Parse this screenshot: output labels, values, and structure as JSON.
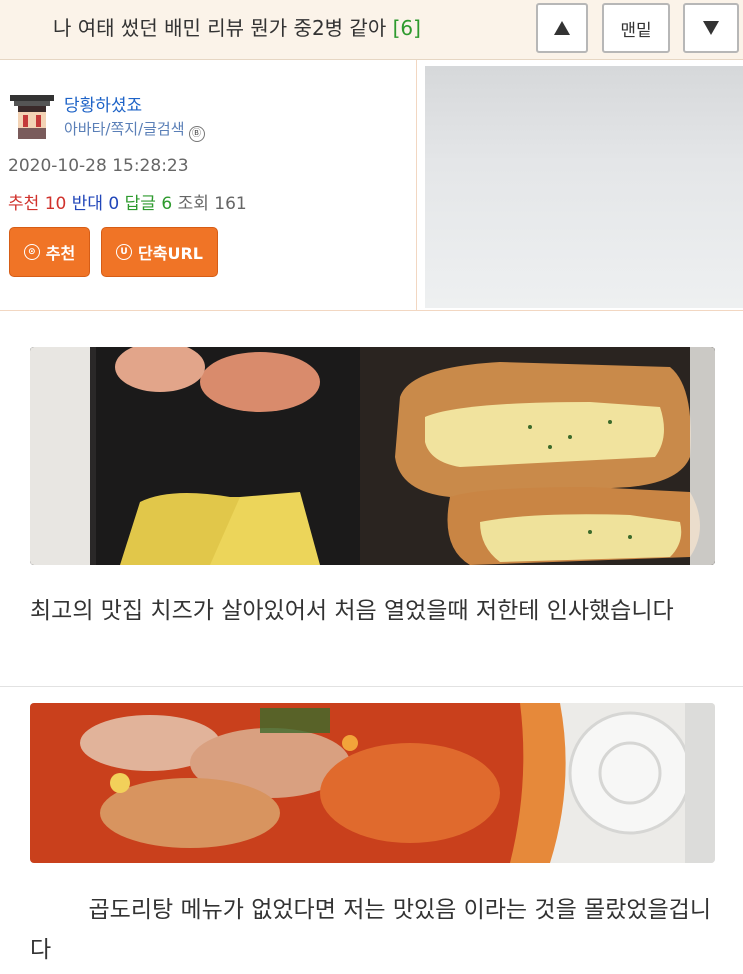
{
  "header": {
    "title": "나 여태 썼던 배민 리뷰 뭔가 중2병 같아",
    "comment_count": "[6]",
    "up_icon": "triangle-up-icon",
    "bottom_label": "맨밑",
    "down_icon": "triangle-down-icon"
  },
  "author": {
    "nickname": "당황하셨죠",
    "links": "아바타/쪽지/글검색",
    "level_badge": "Ⓑ",
    "avatar_icon": "pixel-avatar-icon"
  },
  "post_meta": {
    "datetime": "2020-10-28 15:28:23",
    "recommend_label": "추천",
    "recommend_value": "10",
    "oppose_label": "반대",
    "oppose_value": "0",
    "reply_label": "답글",
    "reply_value": "6",
    "views_label": "조회",
    "views_value": "161"
  },
  "actions": {
    "recommend_button": "추천",
    "recommend_icon_char": "⊙",
    "short_url_button": "단축URL",
    "short_url_icon_char": "U"
  },
  "content": {
    "paragraph1": "최고의 맛집 치즈가 살아있어서 처음 열었을때 저한테 인사했습니다",
    "paragraph2": "        곱도리탕 메뉴가 없었다면 저는 맛있음 이라는 것을 몰랐었을겁니다"
  },
  "colors": {
    "header_bg": "#fbf3e9",
    "link_blue": "#1e63c7",
    "recommend_red": "#d0322c",
    "oppose_blue": "#2146b9",
    "reply_green": "#2e9a2e",
    "button_orange": "#f07426"
  }
}
